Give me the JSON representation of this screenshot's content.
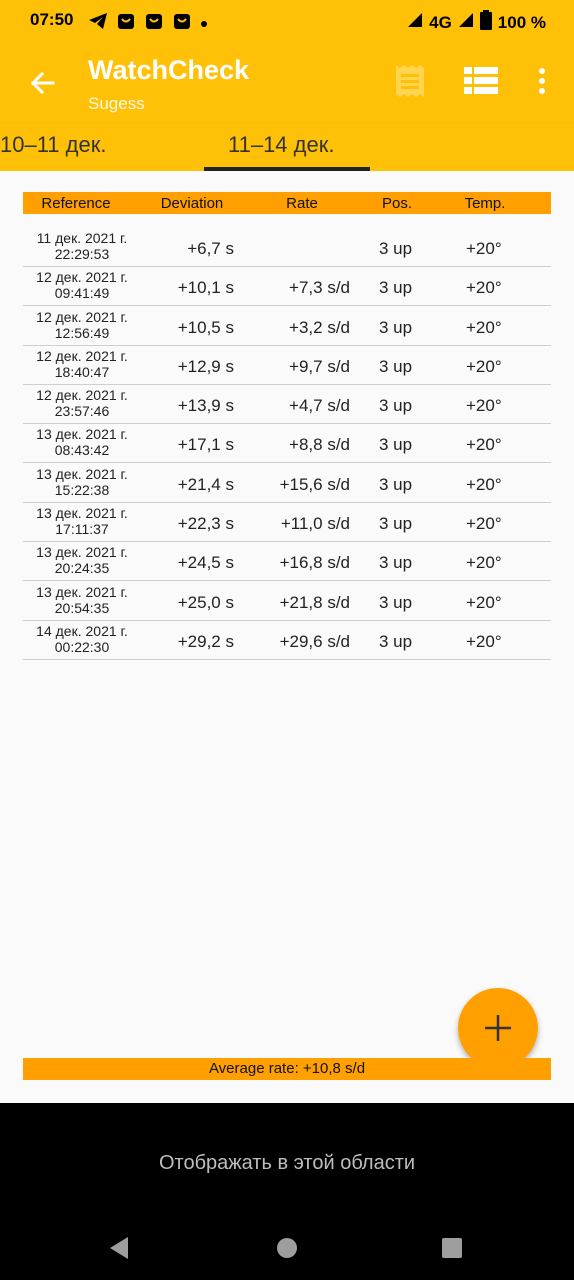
{
  "status": {
    "time": "07:50",
    "network": "4G",
    "battery": "100 %"
  },
  "app": {
    "title": "WatchCheck",
    "subtitle": "Sugess",
    "accent_color": "#ffc107",
    "header_color": "#ffa000"
  },
  "tabs": [
    {
      "label": "10–11 дек.",
      "selected": false
    },
    {
      "label": "11–14 дек.",
      "selected": true
    }
  ],
  "table": {
    "columns": [
      "Reference",
      "Deviation",
      "Rate",
      "Pos.",
      "Temp."
    ],
    "rows": [
      {
        "date": "11 дек. 2021 г.",
        "time": "22:29:53",
        "deviation": "+6,7 s",
        "rate": "",
        "pos": "3 up",
        "temp": "+20°"
      },
      {
        "date": "12 дек. 2021 г.",
        "time": "09:41:49",
        "deviation": "+10,1 s",
        "rate": "+7,3 s/d",
        "pos": "3 up",
        "temp": "+20°"
      },
      {
        "date": "12 дек. 2021 г.",
        "time": "12:56:49",
        "deviation": "+10,5 s",
        "rate": "+3,2 s/d",
        "pos": "3 up",
        "temp": "+20°"
      },
      {
        "date": "12 дек. 2021 г.",
        "time": "18:40:47",
        "deviation": "+12,9 s",
        "rate": "+9,7 s/d",
        "pos": "3 up",
        "temp": "+20°"
      },
      {
        "date": "12 дек. 2021 г.",
        "time": "23:57:46",
        "deviation": "+13,9 s",
        "rate": "+4,7 s/d",
        "pos": "3 up",
        "temp": "+20°"
      },
      {
        "date": "13 дек. 2021 г.",
        "time": "08:43:42",
        "deviation": "+17,1 s",
        "rate": "+8,8 s/d",
        "pos": "3 up",
        "temp": "+20°"
      },
      {
        "date": "13 дек. 2021 г.",
        "time": "15:22:38",
        "deviation": "+21,4 s",
        "rate": "+15,6 s/d",
        "pos": "3 up",
        "temp": "+20°"
      },
      {
        "date": "13 дек. 2021 г.",
        "time": "17:11:37",
        "deviation": "+22,3 s",
        "rate": "+11,0 s/d",
        "pos": "3 up",
        "temp": "+20°"
      },
      {
        "date": "13 дек. 2021 г.",
        "time": "20:24:35",
        "deviation": "+24,5 s",
        "rate": "+16,8 s/d",
        "pos": "3 up",
        "temp": "+20°"
      },
      {
        "date": "13 дек. 2021 г.",
        "time": "20:54:35",
        "deviation": "+25,0 s",
        "rate": "+21,8 s/d",
        "pos": "3 up",
        "temp": "+20°"
      },
      {
        "date": "14 дек. 2021 г.",
        "time": "00:22:30",
        "deviation": "+29,2 s",
        "rate": "+29,6 s/d",
        "pos": "3 up",
        "temp": "+20°"
      }
    ]
  },
  "average_rate": "Average rate: +10,8 s/d",
  "system": {
    "placeholder_text": "Отображать в этой области"
  }
}
